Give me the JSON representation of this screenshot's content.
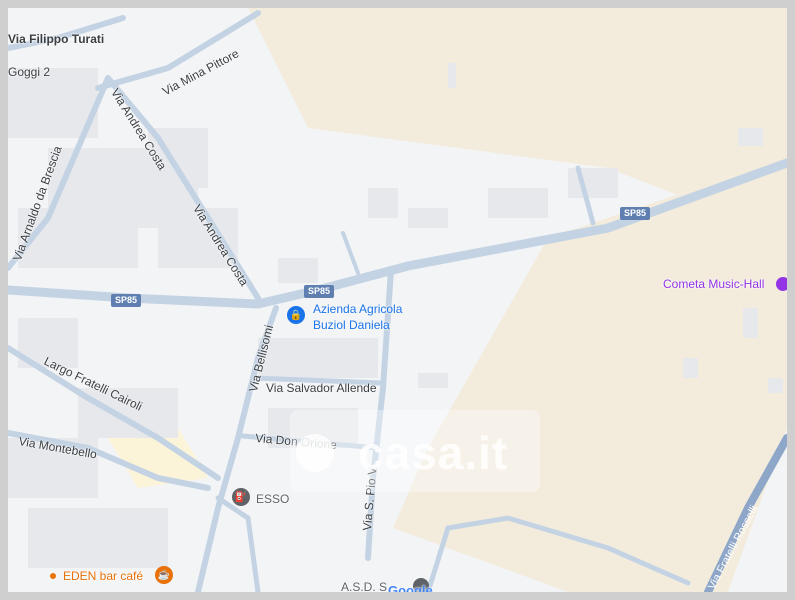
{
  "map": {
    "streets": {
      "via_filippo_turati": "Via Filippo Turati",
      "goggi": "Goggi 2",
      "via_mina_pittore": "Via Mina Pittore",
      "via_andrea_costa_1": "Via Andrea Costa",
      "via_andrea_costa_2": "Via Andrea Costa",
      "via_arnaldo": "Via Arnaldo da Brescia",
      "sp85_a": "SP85",
      "sp85_b": "SP85",
      "sp85_c": "SP85",
      "largo_cairoli": "Largo Fratelli Cairoli",
      "via_montebello": "Via Montebello",
      "via_bellisomi": "Via Bellisomi",
      "via_salvador": "Via Salvador Allende",
      "via_don_orione": "Via Don Orione",
      "via_s_pio": "Via S. Pio V",
      "via_rosselli": "Via Fratelli Rosselli"
    },
    "pois": {
      "azienda_line1": "Azienda Agricola",
      "azienda_line2": "Buziol Daniela",
      "cometa": "Cometa Music-Hall",
      "esso": "ESSO",
      "eden": "EDEN bar café",
      "asd": "A.S.D. S"
    },
    "watermark": "casa.it",
    "attribution": "Google",
    "colors": {
      "land": "#f3f4f6",
      "field": "#f3ecdd",
      "building": "#e6e8ec",
      "road": "#c4d3e3",
      "highlight": "#fcf4d9",
      "poi_blue": "#1a73e8",
      "poi_purple": "#9334e6",
      "poi_orange": "#e8710a",
      "poi_gray": "#5f6368"
    }
  }
}
